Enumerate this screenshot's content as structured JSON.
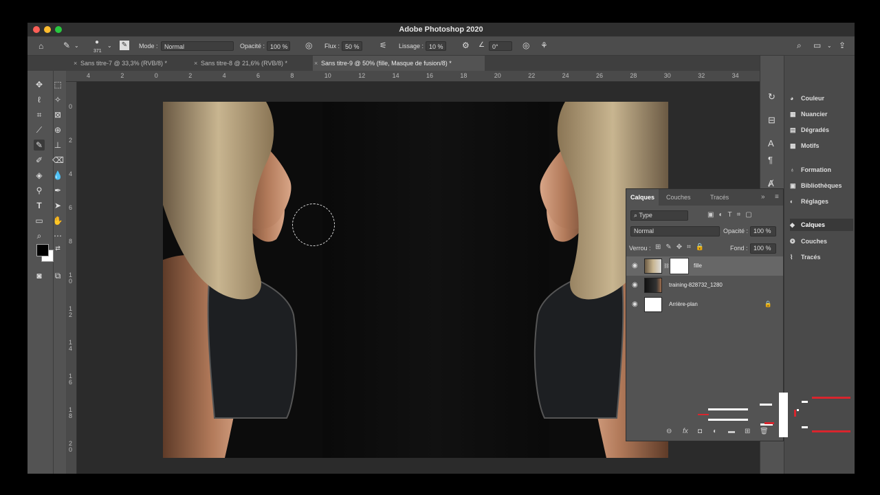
{
  "app": {
    "title": "Adobe Photoshop 2020"
  },
  "options": {
    "brush_size": "371",
    "mode_label": "Mode :",
    "mode_value": "Normal",
    "opacity_label": "Opacité :",
    "opacity_value": "100 %",
    "flow_label": "Flux :",
    "flow_value": "50 %",
    "smoothing_label": "Lissage :",
    "smoothing_value": "10 %",
    "angle_value": "0°"
  },
  "tabs": [
    {
      "label": "Sans titre-7 @ 33,3% (RVB/8) *"
    },
    {
      "label": "Sans titre-8 @ 21,6% (RVB/8) *"
    },
    {
      "label": "Sans titre-9 @ 50% (fille, Masque de fusion/8) *"
    }
  ],
  "ruler_h": [
    "4",
    "2",
    "0",
    "2",
    "4",
    "6",
    "8",
    "10",
    "12",
    "14",
    "16",
    "18",
    "20",
    "22",
    "24",
    "26",
    "28",
    "30",
    "32",
    "34"
  ],
  "ruler_v": [
    "0",
    "2",
    "4",
    "6",
    "8",
    "1 0",
    "1 2",
    "1 4",
    "1 6",
    "1 8",
    "2 0"
  ],
  "panels": [
    {
      "label": "Couleur",
      "icon": "palette-icon"
    },
    {
      "label": "Nuancier",
      "icon": "swatches-icon"
    },
    {
      "label": "Dégradés",
      "icon": "gradient-icon"
    },
    {
      "label": "Motifs",
      "icon": "patterns-icon"
    },
    {
      "label": "Formation",
      "icon": "lightbulb-icon"
    },
    {
      "label": "Bibliothèques",
      "icon": "library-icon"
    },
    {
      "label": "Réglages",
      "icon": "adjustments-icon"
    },
    {
      "label": "Calques",
      "icon": "layers-icon"
    },
    {
      "label": "Couches",
      "icon": "channels-icon"
    },
    {
      "label": "Tracés",
      "icon": "paths-icon"
    }
  ],
  "layers_panel": {
    "tabs": [
      "Calques",
      "Couches",
      "Tracés"
    ],
    "filter": "Type",
    "blend_mode": "Normal",
    "opacity_label": "Opacité :",
    "opacity_value": "100 %",
    "lock_label": "Verrou :",
    "fill_label": "Fond :",
    "fill_value": "100 %",
    "layers": [
      {
        "name": "fille"
      },
      {
        "name": "training-828732_1280"
      },
      {
        "name": "Arrière-plan"
      }
    ]
  },
  "colors": {
    "accent_red": "#d9252d",
    "foreground": "#000000",
    "background": "#ffffff"
  }
}
